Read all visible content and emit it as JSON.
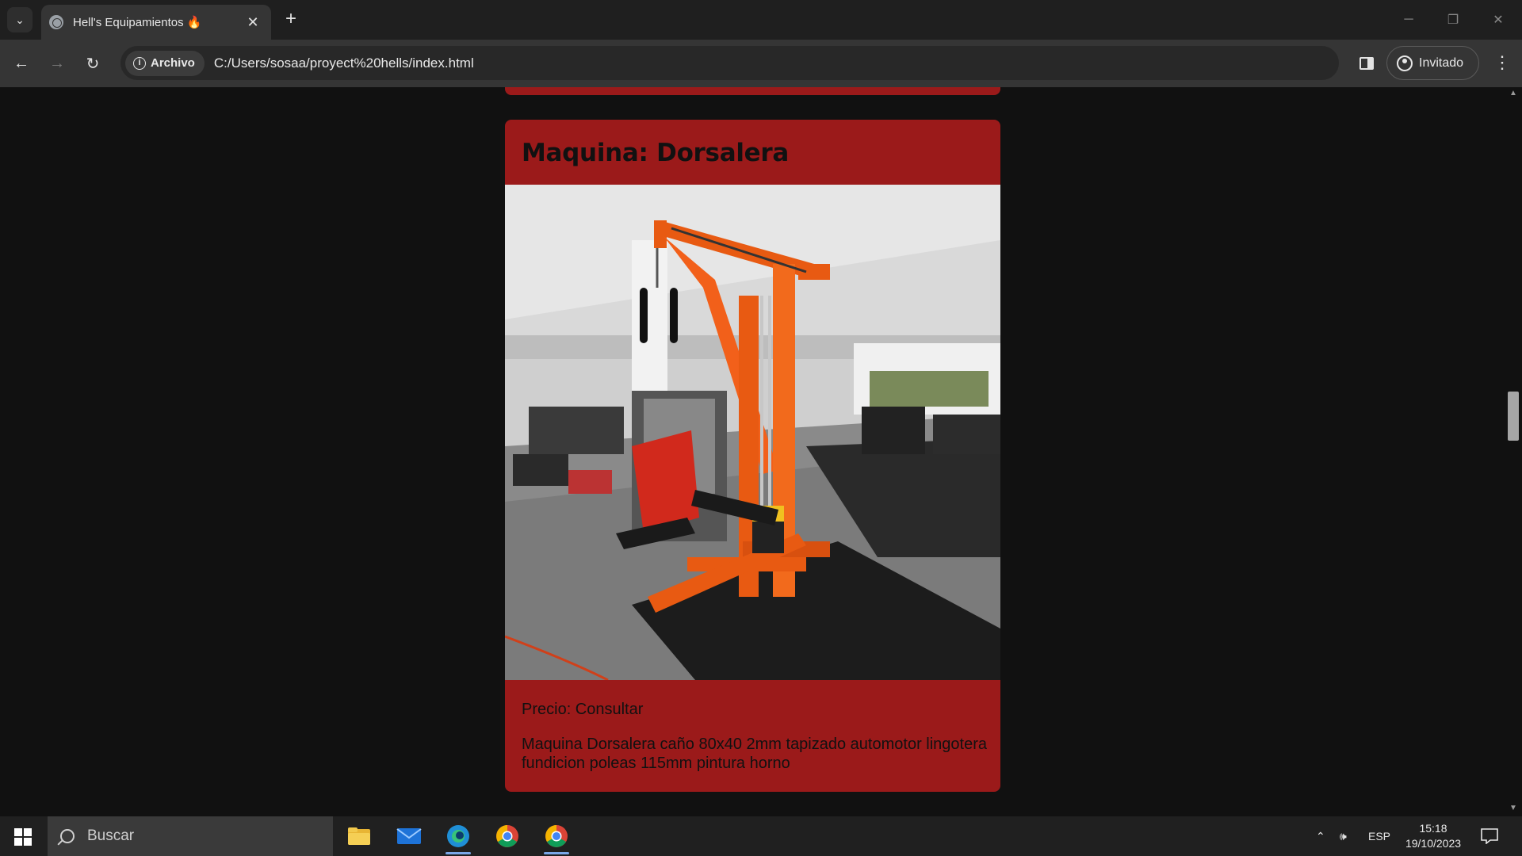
{
  "browser": {
    "tab_title": "Hell's Equipamientos 🔥",
    "tab_close": "✕",
    "new_tab": "+",
    "security_chip": "Archivo",
    "url": "C:/Users/sosaa/proyect%20hells/index.html",
    "profile_label": "Invitado"
  },
  "page": {
    "card_title": "Maquina: Dorsalera",
    "price": "Precio: Consultar",
    "description": "Maquina Dorsalera caño 80x40 2mm tapizado automotor lingotera fundicion poleas 115mm pintura horno",
    "accent_color": "#9b1a1a"
  },
  "taskbar": {
    "search_placeholder": "Buscar",
    "language": "ESP",
    "time": "15:18",
    "date": "19/10/2023"
  }
}
